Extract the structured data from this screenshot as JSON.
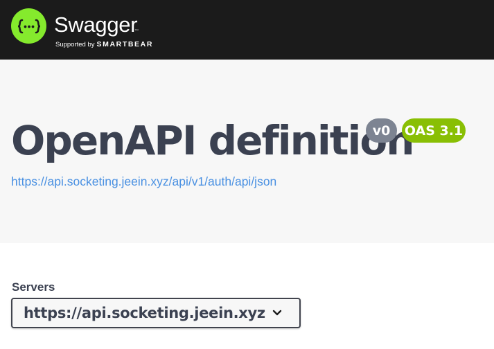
{
  "topbar": {
    "logo_title": "Swagger",
    "logo_tm": "™",
    "supported_by": "Supported by",
    "smartbear": "SMARTBEAR",
    "colors": {
      "background": "#1b1b1b",
      "logo": "#85ea2d"
    }
  },
  "info": {
    "title": "OpenAPI definition",
    "version_badge": "v0",
    "oas_badge": "OAS 3.1",
    "spec_url": "https://api.socketing.jeein.xyz/api/v1/auth/api/json",
    "colors": {
      "version_badge": "#7d8492",
      "oas_badge": "#89bf04",
      "link": "#4990e2"
    }
  },
  "servers": {
    "label": "Servers",
    "selected": "https://api.socketing.jeein.xyz",
    "icon": "chevron-down-icon"
  }
}
